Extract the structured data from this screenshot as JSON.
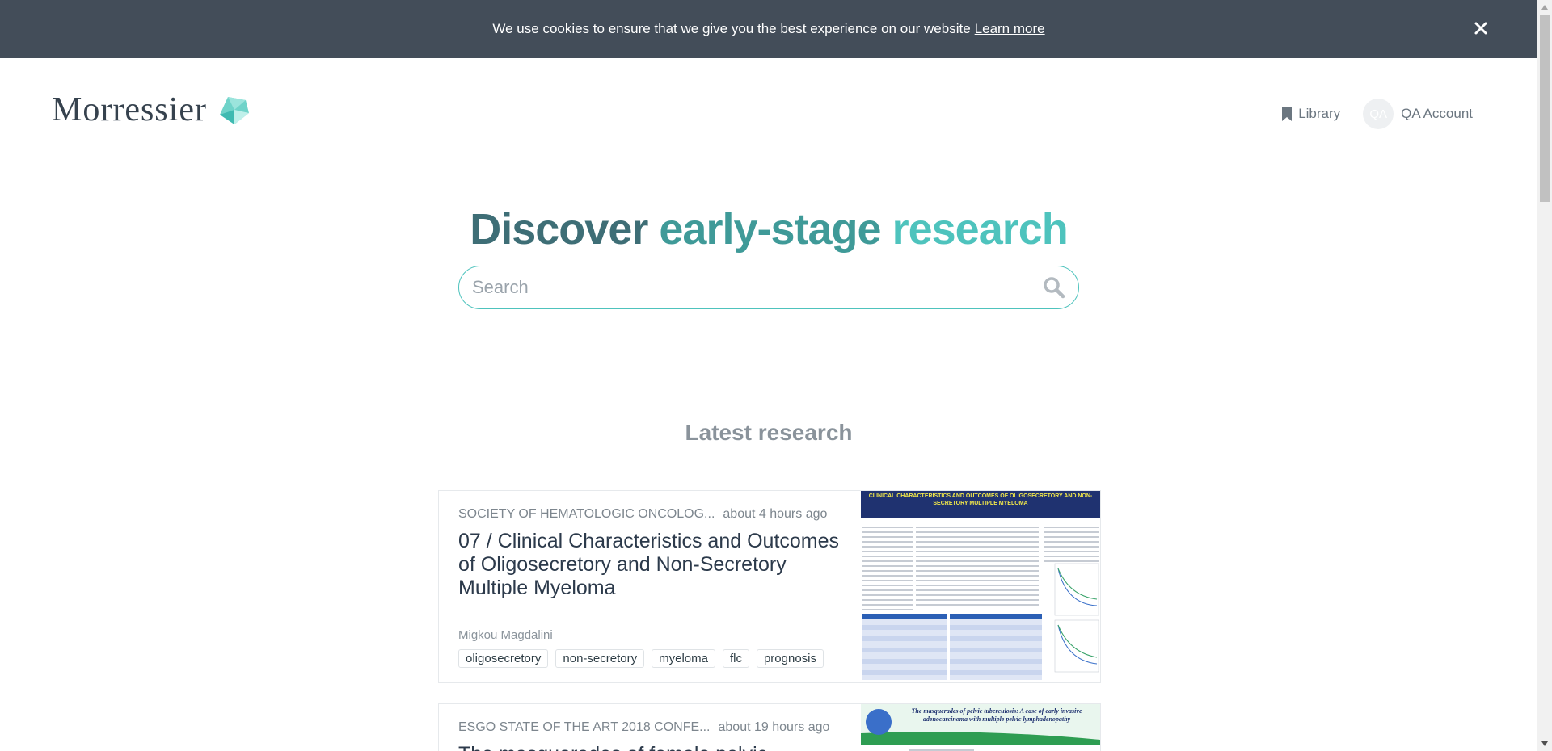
{
  "cookie_banner": {
    "message": "We use cookies to ensure that we give you the best experience on our website",
    "link_label": "Learn more",
    "close_icon": "close-icon"
  },
  "header": {
    "logo_text": "Morressier",
    "nav": {
      "library_label": "Library",
      "library_icon": "bookmark-icon",
      "account_initials": "QA",
      "account_label": "QA Account"
    }
  },
  "hero": {
    "title_part1": "Discover",
    "title_part2": "early-stage",
    "title_part3": "research",
    "search_placeholder": "Search",
    "search_icon": "search-icon"
  },
  "latest": {
    "title": "Latest research",
    "cards": [
      {
        "source": "SOCIETY OF HEMATOLOGIC ONCOLOG...",
        "time": "about 4 hours ago",
        "title": "07 / Clinical Characteristics and Outcomes of Oligosecretory and Non-Secretory Multiple Myeloma",
        "author": "Migkou Magdalini",
        "tags": [
          "oligosecretory",
          "non-secretory",
          "myeloma",
          "flc",
          "prognosis"
        ],
        "poster_heading": "CLINICAL CHARACTERISTICS AND OUTCOMES OF OLIGOSECRETORY AND NON-SECRETORY MULTIPLE MYELOMA"
      },
      {
        "source": "ESGO STATE OF THE ART 2018 CONFE...",
        "time": "about 19 hours ago",
        "title": "The masquerades of female pelvic",
        "poster_heading": "The masquerades of pelvic tuberculosis: A case of early invasive adenocarcinoma with multiple pelvic lymphadenopathy"
      }
    ]
  },
  "colors": {
    "banner_bg": "#434d59",
    "accent": "#4ec3bd",
    "title_dark": "#3e6e76",
    "title_mid": "#3f9a98",
    "title_light": "#4ec3bd"
  }
}
